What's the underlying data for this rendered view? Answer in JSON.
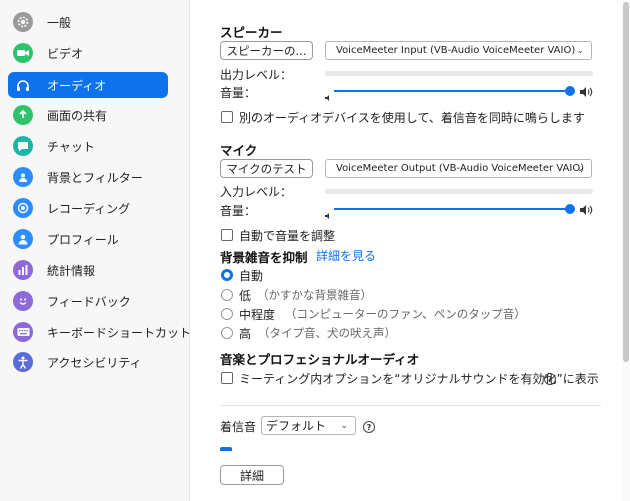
{
  "sidebar": {
    "items": [
      {
        "label": "一般",
        "icon": "gear-icon",
        "color": "#9a9a9a",
        "active": false
      },
      {
        "label": "ビデオ",
        "icon": "video-camera-icon",
        "color": "#2fc46b",
        "active": false
      },
      {
        "label": "オーディオ",
        "icon": "headphones-icon",
        "color": "#ffffff",
        "active": true
      },
      {
        "label": "画面の共有",
        "icon": "share-screen-icon",
        "color": "#2fc46b",
        "active": false
      },
      {
        "label": "チャット",
        "icon": "chat-bubble-icon",
        "color": "#1fb5a6",
        "active": false
      },
      {
        "label": "背景とフィルター",
        "icon": "background-filter-icon",
        "color": "#2d8cff",
        "active": false
      },
      {
        "label": "レコーディング",
        "icon": "record-icon",
        "color": "#2d8cff",
        "active": false
      },
      {
        "label": "プロフィール",
        "icon": "profile-icon",
        "color": "#2d8cff",
        "active": false
      },
      {
        "label": "統計情報",
        "icon": "statistics-icon",
        "color": "#8e6ad8",
        "active": false
      },
      {
        "label": "フィードバック",
        "icon": "feedback-smile-icon",
        "color": "#8e6ad8",
        "active": false
      },
      {
        "label": "キーボードショートカット",
        "icon": "keyboard-icon",
        "color": "#8e6ad8",
        "active": false
      },
      {
        "label": "アクセシビリティ",
        "icon": "accessibility-icon",
        "color": "#5b6bd8",
        "active": false
      }
    ]
  },
  "speaker": {
    "title": "スピーカー",
    "test_button": "スピーカーの...",
    "device": "VoiceMeeter Input (VB-Audio VoiceMeeter VAIO)",
    "output_level_label": "出力レベル：",
    "volume_label": "音量：",
    "volume_value": 0.94
  },
  "separate_device": {
    "label": "別のオーディオデバイスを使用して、着信音を同時に鳴らします",
    "checked": false
  },
  "mic": {
    "title": "マイク",
    "test_button": "マイクのテスト",
    "device": "VoiceMeeter Output (VB-Audio VoiceMeeter VAIO)",
    "input_level_label": "入力レベル：",
    "volume_label": "音量：",
    "volume_value": 0.94
  },
  "auto_adjust": {
    "label": "自動で音量を調整",
    "checked": false
  },
  "noise": {
    "title": "背景雑音を抑制",
    "link": "詳細を見る",
    "options": [
      {
        "label": "自動",
        "note": "",
        "selected": true
      },
      {
        "label": "低",
        "note": "（かすかな背景雑音）",
        "selected": false
      },
      {
        "label": "中程度",
        "note": "（コンピューターのファン、ペンのタップ音）",
        "selected": false
      },
      {
        "label": "高",
        "note": "（タイプ音、犬の吠え声）",
        "selected": false
      }
    ]
  },
  "music": {
    "title": "音楽とプロフェショナルオーディオ",
    "option_label": "ミーティング内オプションを“オリジナルサウンドを有効化”に表示",
    "checked": false
  },
  "ringtone": {
    "label": "着信音",
    "value": "デフォルト"
  },
  "footer": {
    "details_button": "詳細"
  },
  "colors": {
    "accent": "#0e72ed"
  }
}
